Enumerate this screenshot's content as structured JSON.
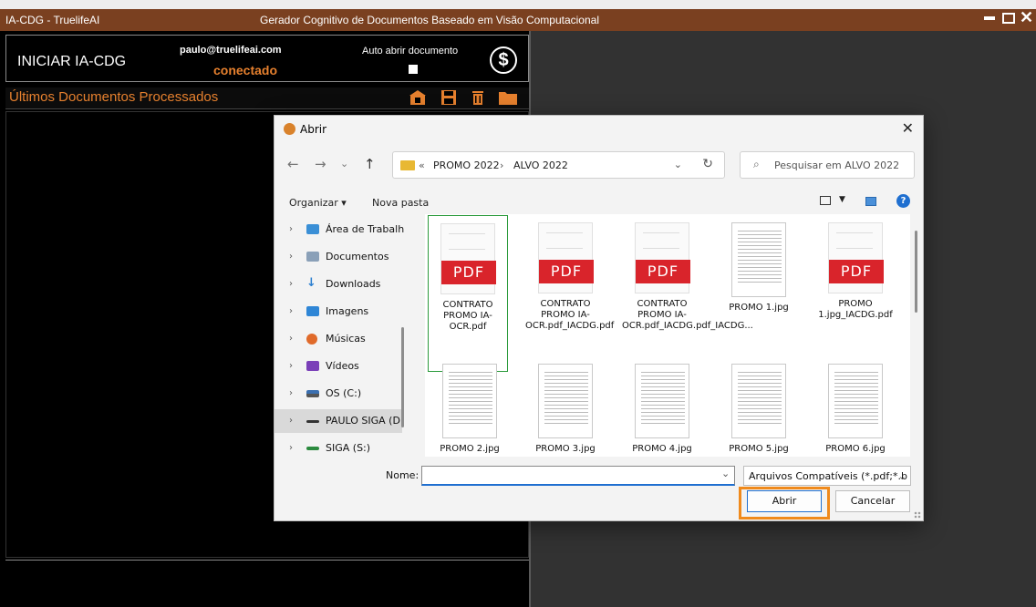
{
  "app": {
    "title": "IA-CDG - TruelifeAI",
    "subtitle": "Gerador Cognitivo de Documentos Baseado em Visão Computacional",
    "start_button": "INICIAR IA-CDG",
    "user_email": "paulo@truelifeai.com",
    "status": "conectado",
    "auto_open_label": "Auto abrir documento",
    "dollar_symbol": "$",
    "recent_docs_title": "Últimos Documentos Processados",
    "accent_color": "#e6802e",
    "titlebar_color": "#7a4020"
  },
  "dialog": {
    "title": "Abrir",
    "close_glyph": "✕",
    "nav": {
      "back": "←",
      "forward": "→",
      "recent": "⌄",
      "up": "↑"
    },
    "breadcrumb_prefix": "«",
    "breadcrumb": [
      "PROMO 2022",
      "ALVO 2022"
    ],
    "breadcrumb_sep": "›",
    "address_dropdown": "⌄",
    "refresh_glyph": "↻",
    "search_placeholder": "Pesquisar em ALVO 2022",
    "organize_label": "Organizar ▾",
    "new_folder_label": "Nova pasta",
    "nav_items": [
      {
        "label": "Área de Trabalh",
        "icon": "desktop-icon",
        "color": "#3a8fd6"
      },
      {
        "label": "Documentos",
        "icon": "documents-icon",
        "color": "#8aa0b8"
      },
      {
        "label": "Downloads",
        "icon": "downloads-icon",
        "color": "#2b7fd0"
      },
      {
        "label": "Imagens",
        "icon": "images-icon",
        "color": "#2f86d6"
      },
      {
        "label": "Músicas",
        "icon": "music-icon",
        "color": "#e06a2a"
      },
      {
        "label": "Vídeos",
        "icon": "videos-icon",
        "color": "#7a3fb8"
      },
      {
        "label": "OS (C:)",
        "icon": "drive-icon",
        "color": "#3b6fb0"
      },
      {
        "label": "PAULO SIGA (D",
        "icon": "drive-icon",
        "color": "#333333"
      },
      {
        "label": "SIGA (S:)",
        "icon": "drive-icon",
        "color": "#2b8a3e"
      }
    ],
    "files": [
      {
        "name": "CONTRATO PROMO IA-OCR.pdf",
        "type": "pdf"
      },
      {
        "name": "CONTRATO PROMO IA-OCR.pdf_IACDG.pdf",
        "type": "pdf"
      },
      {
        "name": "CONTRATO PROMO IA-OCR.pdf_IACDG.pdf_IACDG...",
        "type": "pdf"
      },
      {
        "name": "PROMO 1.jpg",
        "type": "img"
      },
      {
        "name": "PROMO 1.jpg_IACDG.pdf",
        "type": "pdf"
      },
      {
        "name": "PROMO 2.jpg",
        "type": "img"
      },
      {
        "name": "PROMO 3.jpg",
        "type": "img"
      },
      {
        "name": "PROMO 4.jpg",
        "type": "img"
      },
      {
        "name": "PROMO 5.jpg",
        "type": "img"
      },
      {
        "name": "PROMO 6.jpg",
        "type": "img"
      }
    ],
    "pdf_badge": "PDF",
    "name_label": "Nome:",
    "name_value": "",
    "name_dropdown": "⌄",
    "filter_value": "Arquivos Compatíveis (*.pdf;*.b",
    "filter_dropdown": "⌄",
    "open_button": "Abrir",
    "cancel_button": "Cancelar",
    "highlight_color": "#f08a1c"
  }
}
